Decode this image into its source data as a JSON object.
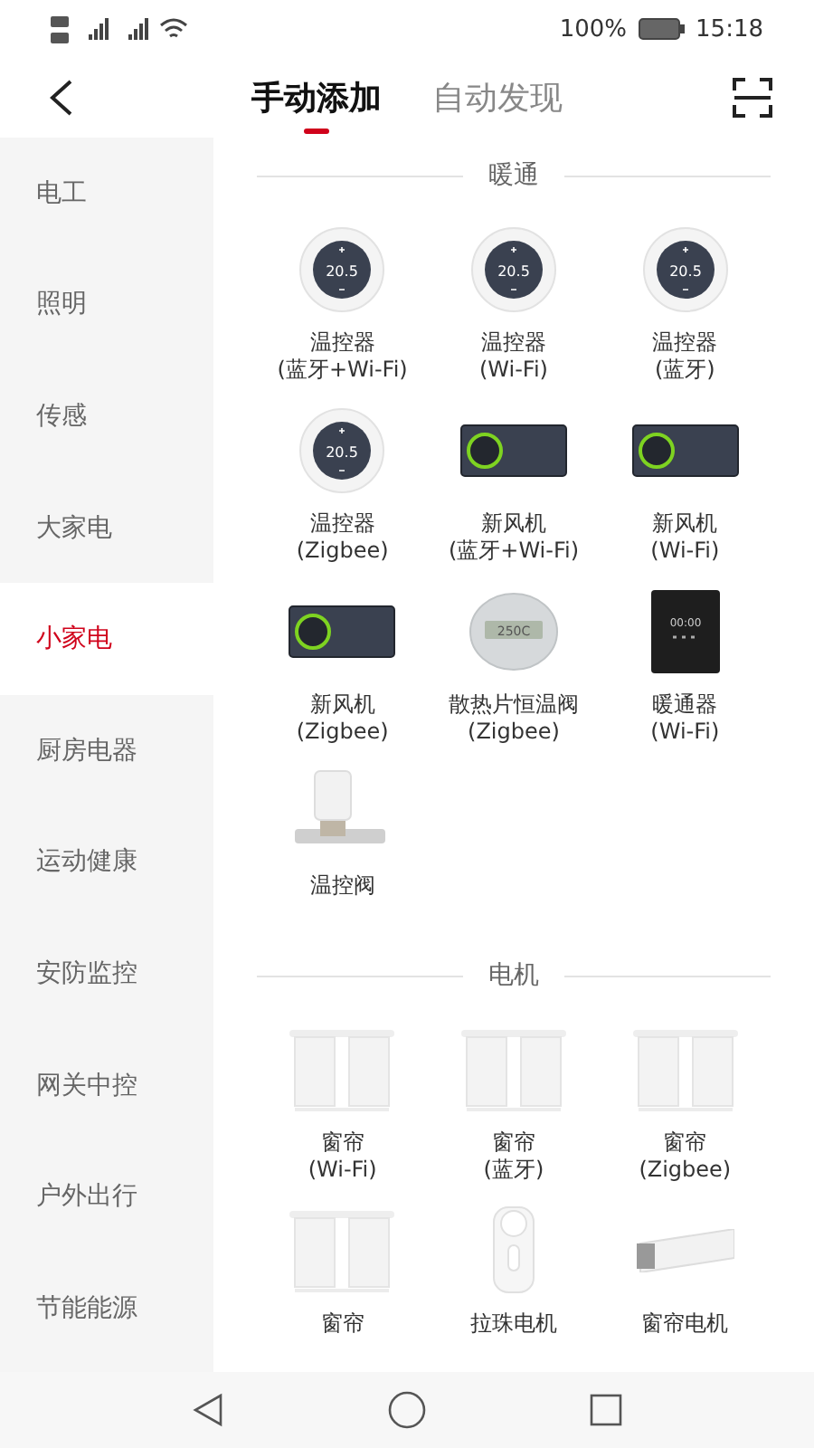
{
  "status_bar": {
    "battery": "100%",
    "time": "15:18"
  },
  "header": {
    "tabs": [
      {
        "label": "手动添加",
        "selected": true
      },
      {
        "label": "自动发现",
        "selected": false
      }
    ]
  },
  "sidebar": {
    "items": [
      {
        "label": "电工",
        "selected": false
      },
      {
        "label": "照明",
        "selected": false
      },
      {
        "label": "传感",
        "selected": false
      },
      {
        "label": "大家电",
        "selected": false
      },
      {
        "label": "小家电",
        "selected": true
      },
      {
        "label": "厨房电器",
        "selected": false
      },
      {
        "label": "运动健康",
        "selected": false
      },
      {
        "label": "安防监控",
        "selected": false
      },
      {
        "label": "网关中控",
        "selected": false
      },
      {
        "label": "户外出行",
        "selected": false
      },
      {
        "label": "节能能源",
        "selected": false
      }
    ]
  },
  "sections": [
    {
      "title": "暖通",
      "items": [
        {
          "kind": "thermostat",
          "display": "20.5",
          "name": "温控器",
          "variant": "(蓝牙+Wi-Fi)"
        },
        {
          "kind": "thermostat",
          "display": "20.5",
          "name": "温控器",
          "variant": "(Wi-Fi)"
        },
        {
          "kind": "thermostat",
          "display": "20.5",
          "name": "温控器",
          "variant": "(蓝牙)"
        },
        {
          "kind": "thermostat",
          "display": "20.5",
          "name": "温控器",
          "variant": "(Zigbee)"
        },
        {
          "kind": "fresh-air",
          "name": "新风机",
          "variant": "(蓝牙+Wi-Fi)"
        },
        {
          "kind": "fresh-air",
          "name": "新风机",
          "variant": "(Wi-Fi)"
        },
        {
          "kind": "fresh-air",
          "name": "新风机",
          "variant": "(Zigbee)"
        },
        {
          "kind": "radiator-valve",
          "display": "250C",
          "name": "散热片恒温阀",
          "variant": "(Zigbee)"
        },
        {
          "kind": "heater",
          "display": "00:00",
          "name": "暖通器",
          "variant": "(Wi-Fi)"
        },
        {
          "kind": "valve",
          "name": "温控阀"
        }
      ]
    },
    {
      "title": "电机",
      "items": [
        {
          "kind": "curtain",
          "name": "窗帘",
          "variant": "(Wi-Fi)"
        },
        {
          "kind": "curtain",
          "name": "窗帘",
          "variant": "(蓝牙)"
        },
        {
          "kind": "curtain",
          "name": "窗帘",
          "variant": "(Zigbee)"
        },
        {
          "kind": "curtain",
          "name": "窗帘"
        },
        {
          "kind": "pull-bead-motor",
          "name": "拉珠电机"
        },
        {
          "kind": "curtain-motor",
          "name": "窗帘电机"
        }
      ]
    }
  ]
}
